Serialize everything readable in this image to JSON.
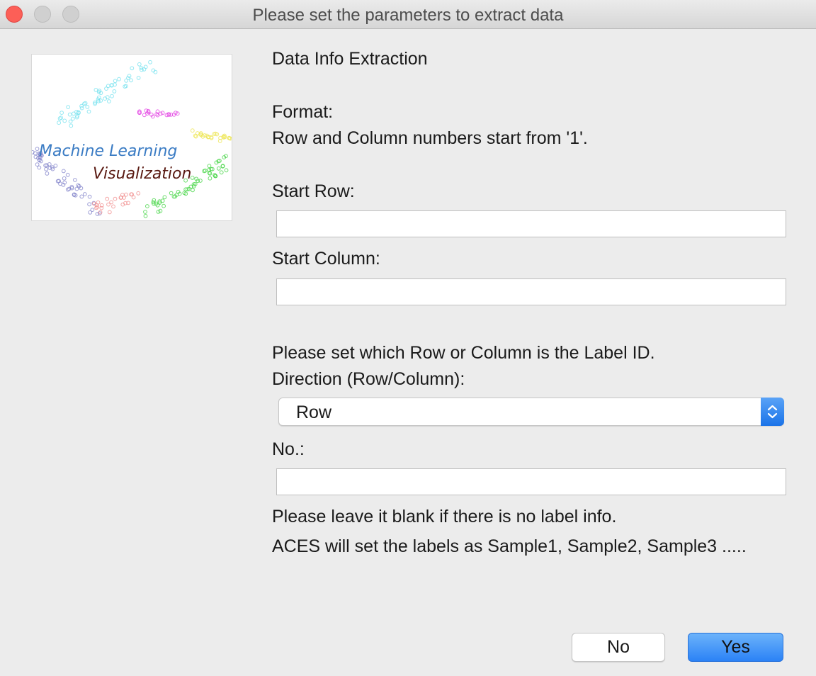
{
  "window": {
    "title": "Please set the parameters to extract data"
  },
  "logo": {
    "line1": "Machine Learning",
    "line2": "Visualization"
  },
  "form": {
    "heading": "Data Info Extraction",
    "format_label": "Format:",
    "format_note": "Row and Column numbers start from '1'.",
    "start_row_label": "Start Row:",
    "start_row_value": "",
    "start_column_label": "Start Column:",
    "start_column_value": "",
    "label_id_note": "Please set which Row or Column is the Label ID.",
    "direction_label": "Direction (Row/Column):",
    "direction_value": "Row",
    "no_label": "No.:",
    "no_value": "",
    "blank_note": "Please leave it blank if there is no label info.",
    "aces_note": "ACES will set the labels as Sample1, Sample2, Sample3 ....."
  },
  "buttons": {
    "no": "No",
    "yes": "Yes"
  },
  "colors": {
    "accent": "#2b82f6",
    "close": "#fc5f57"
  }
}
